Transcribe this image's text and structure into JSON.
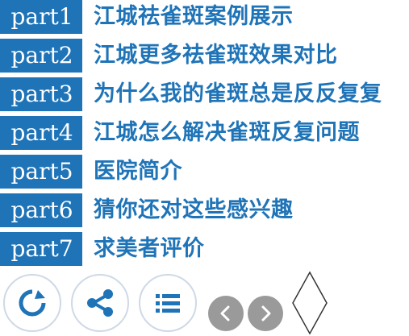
{
  "menu": {
    "items": [
      {
        "part": "part1",
        "title": "江城祛雀斑案例展示"
      },
      {
        "part": "part2",
        "title": "江城更多祛雀斑效果对比"
      },
      {
        "part": "part3",
        "title": "为什么我的雀斑总是反反复复"
      },
      {
        "part": "part4",
        "title": "江城怎么解决雀斑反复问题"
      },
      {
        "part": "part5",
        "title": "医院简介"
      },
      {
        "part": "part6",
        "title": "猜你还对这些感兴趣"
      },
      {
        "part": "part7",
        "title": "求美者评价"
      }
    ]
  },
  "icons": {
    "refresh": "refresh-icon",
    "share": "share-icon",
    "list": "list-icon",
    "prev": "chevron-left-icon",
    "next": "chevron-right-icon",
    "diamond": "diamond-icon"
  },
  "colors": {
    "accent": "#1f74b8",
    "icon_circle_border": "#cfd9e6",
    "nav_gray": "#9a9a9a",
    "white": "#ffffff"
  }
}
